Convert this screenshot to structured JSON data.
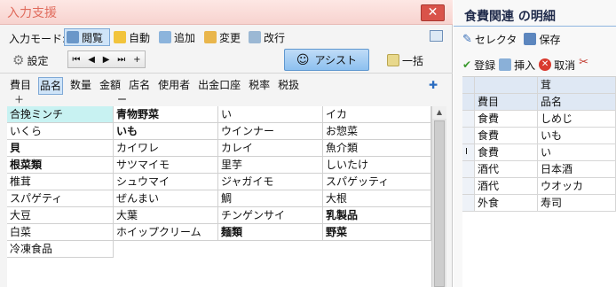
{
  "dialog": {
    "title": "入力支援",
    "close": "✕",
    "input_mode_label": "入力モード:",
    "modes": [
      "閲覧",
      "自動",
      "追加",
      "変更",
      "改行"
    ],
    "settings": "設定",
    "nav": [
      "⏮",
      "◀",
      "▶",
      "⏭",
      "+"
    ],
    "assist": "アシスト",
    "bulk": "一括",
    "fields": [
      "費目",
      "品名",
      "数量",
      "金額",
      "店名",
      "使用者",
      "出金口座",
      "税率",
      "税扱"
    ],
    "add_row": [
      "＋",
      "ー"
    ],
    "grid": [
      [
        "合挽ミンチ",
        "青物野菜",
        "い",
        "イカ"
      ],
      [
        "いくら",
        "いも",
        "ウインナー",
        "お惣菜"
      ],
      [
        "貝",
        "カイワレ",
        "カレイ",
        "魚介類"
      ],
      [
        "根菜類",
        "サツマイモ",
        "里芋",
        "しいたけ"
      ],
      [
        "椎茸",
        "シュウマイ",
        "ジャガイモ",
        "スパゲッティ"
      ],
      [
        "スパゲティ",
        "ぜんまい",
        "鯛",
        "大根"
      ],
      [
        "大豆",
        "大葉",
        "チンゲンサイ",
        "乳製品"
      ],
      [
        "白菜",
        "ホイップクリーム",
        "麺類",
        "野菜"
      ],
      [
        "冷凍食品"
      ]
    ],
    "bold_cells": [
      "青物野菜",
      "いも",
      "貝",
      "根菜類",
      "乳製品",
      "麺類",
      "野菜"
    ],
    "highlight_cell": "合挽ミンチ"
  },
  "detail": {
    "title": "食費関連 の明細",
    "toolbar1": [
      "セレクタ",
      "保存"
    ],
    "toolbar2": [
      "登録",
      "挿入",
      "取消"
    ],
    "header_top": "茸",
    "col_category": "費目",
    "col_name": "品名",
    "rows": [
      {
        "indicator": "",
        "category": "食費",
        "name": "しめじ"
      },
      {
        "indicator": "",
        "category": "食費",
        "name": "いも"
      },
      {
        "indicator": "I",
        "category": "食費",
        "name": "い"
      },
      {
        "indicator": "",
        "category": "酒代",
        "name": "日本酒"
      },
      {
        "indicator": "",
        "category": "酒代",
        "name": "ウオッカ"
      },
      {
        "indicator": "",
        "category": "外食",
        "name": "寿司"
      }
    ]
  },
  "colors": {
    "title_text": "#e06b5c",
    "close_bg": "#d9534a",
    "selected": "#cfe4f8",
    "highlight": "#c8f2f2"
  }
}
